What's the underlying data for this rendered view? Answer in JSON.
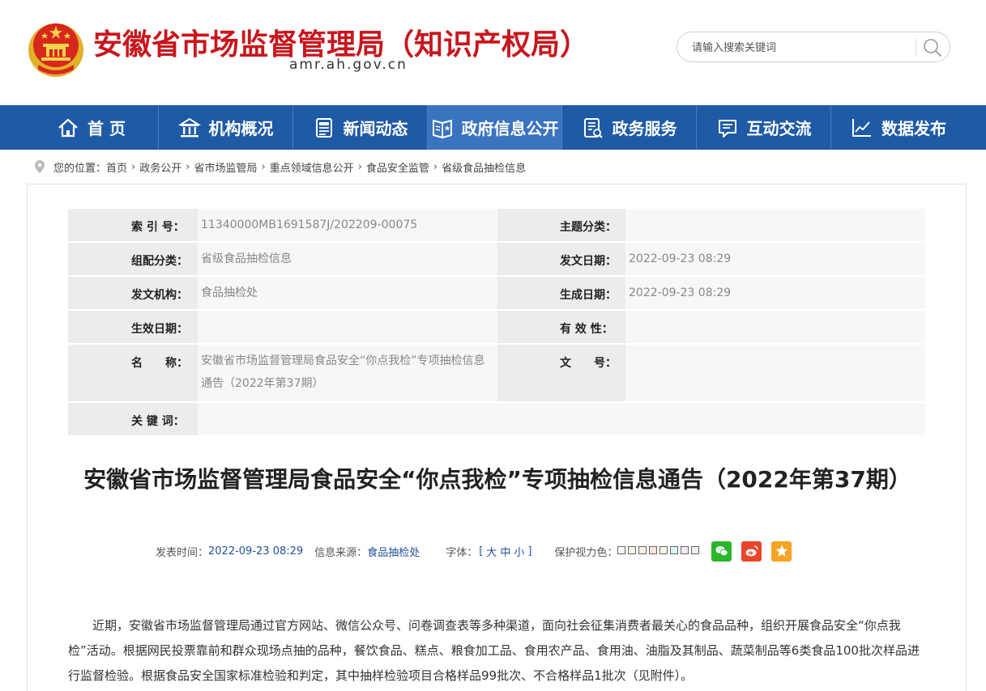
{
  "header": {
    "site_title": "安徽省市场监督管理局（知识产权局）",
    "site_domain": "amr.ah.gov.cn",
    "search_placeholder": "请输入搜索关键词"
  },
  "nav": {
    "items": [
      {
        "label": "首 页",
        "icon": "home-icon"
      },
      {
        "label": "机构概况",
        "icon": "institution-icon"
      },
      {
        "label": "新闻动态",
        "icon": "news-icon"
      },
      {
        "label": "政府信息公开",
        "icon": "gov-info-icon"
      },
      {
        "label": "政务服务",
        "icon": "service-icon"
      },
      {
        "label": "互动交流",
        "icon": "chat-icon"
      },
      {
        "label": "数据发布",
        "icon": "chart-icon"
      }
    ]
  },
  "breadcrumb": {
    "prefix": "您的位置：",
    "items": [
      "首页",
      "政务公开",
      "省市场监管局",
      "重点领域信息公开",
      "食品安全监管",
      "省级食品抽检信息"
    ],
    "separator": "›"
  },
  "meta": {
    "index_label": "索 引 号：",
    "index_value": "11340000MB1691587J/202209-00075",
    "topic_label": "主题分类：",
    "topic_value": "",
    "category_label": "组配分类：",
    "category_value": "省级食品抽检信息",
    "issue_date_label": "发文日期：",
    "issue_date_value": "2022-09-23 08:29",
    "issuer_label": "发文机构：",
    "issuer_value": "食品抽检处",
    "gen_date_label": "生成日期：",
    "gen_date_value": "2022-09-23 08:29",
    "effective_label": "生效日期：",
    "effective_value": "",
    "validity_label": "有 效 性：",
    "validity_value": "",
    "name_label": "名　　称：",
    "name_value": "安徽省市场监督管理局食品安全“你点我检”专项抽检信息通告（2022年第37期）",
    "docno_label": "文　　号：",
    "docno_value": "",
    "keywords_label": "关 键 词："
  },
  "article": {
    "title": "安徽省市场监督管理局食品安全“你点我检”专项抽检信息通告（2022年第37期）",
    "publish_label": "发表时间：",
    "publish_time": "2022-09-23 08:29",
    "source_label": "信息来源：",
    "source": "食品抽检处",
    "font_label": "字体：",
    "font_open": "[",
    "font_large": "大",
    "font_medium": "中",
    "font_small": "小",
    "font_close": "]",
    "eye_label": "保护视力色：",
    "eye_colors": [
      "#ffffff",
      "#fafbe6",
      "#fff2e2",
      "#fde6e0",
      "#f3ffe1",
      "#dafaf7",
      "#f3e8ff",
      "#f0f0f0"
    ],
    "share_wechat_color": "#2bb52b",
    "share_weibo_color": "#e8462a",
    "share_fav_color": "#f7a325",
    "body": "近期，安徽省市场监督管理局通过官方网站、微信公众号、问卷调查表等多种渠道，面向社会征集消费者最关心的食品品种，组织开展食品安全“你点我检”活动。根据网民投票靠前和群众现场点抽的品种，餐饮食品、糕点、粮食加工品、食用农产品、食用油、油脂及其制品、蔬菜制品等6类食品100批次样品进行监督检验。根据食品安全国家标准检验和判定，其中抽样检验项目合格样品99批次、不合格样品1批次（见附件）。"
  },
  "colors": {
    "brand_red": "#c8161d",
    "nav_blue": "#1f5aa7",
    "nav_active": "#3a74c0",
    "link_blue": "#1f4f9a"
  }
}
